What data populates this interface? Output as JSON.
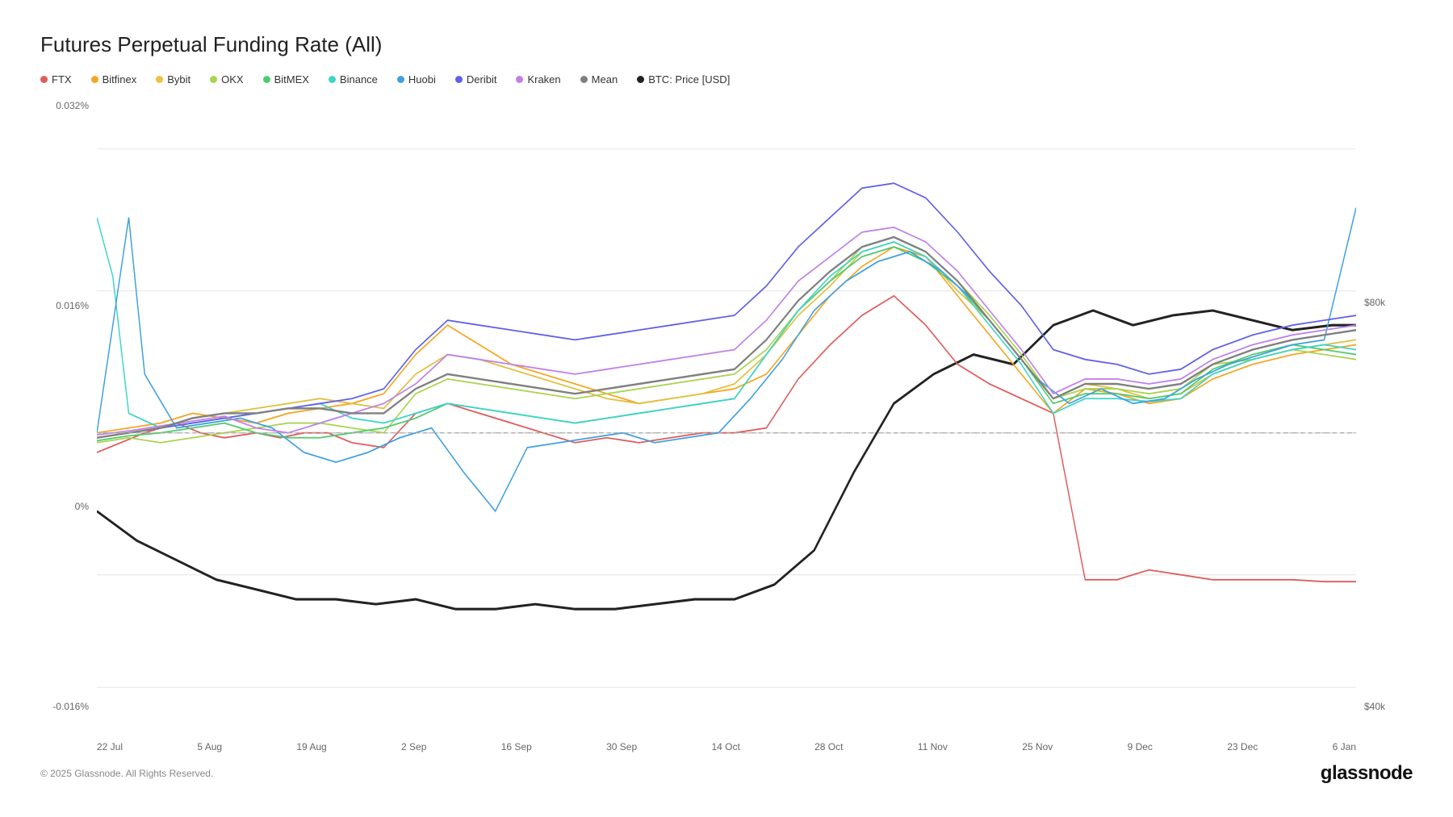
{
  "title": "Futures Perpetual Funding Rate (All)",
  "legend": [
    {
      "label": "FTX",
      "color": "#e05c5c"
    },
    {
      "label": "Bitfinex",
      "color": "#f5a623"
    },
    {
      "label": "Bybit",
      "color": "#f0c040"
    },
    {
      "label": "OKX",
      "color": "#a8d44e"
    },
    {
      "label": "BitMEX",
      "color": "#4ecb6e"
    },
    {
      "label": "Binance",
      "color": "#40d4c8"
    },
    {
      "label": "Huobi",
      "color": "#40a0e0"
    },
    {
      "label": "Deribit",
      "color": "#6060e8"
    },
    {
      "label": "Kraken",
      "color": "#c080e8"
    },
    {
      "label": "Mean",
      "color": "#808080"
    },
    {
      "label": "BTC: Price [USD]",
      "color": "#222222"
    }
  ],
  "yAxis": {
    "left": [
      "0.032%",
      "0.016%",
      "0%",
      "-0.016%"
    ],
    "right": [
      "$80k",
      "$40k"
    ]
  },
  "xAxis": [
    "22 Jul",
    "5 Aug",
    "19 Aug",
    "2 Sep",
    "16 Sep",
    "30 Sep",
    "14 Oct",
    "28 Oct",
    "11 Nov",
    "25 Nov",
    "9 Dec",
    "23 Dec",
    "6 Jan"
  ],
  "footer": {
    "copyright": "© 2025 Glassnode. All Rights Reserved.",
    "brand": "glassnode"
  }
}
